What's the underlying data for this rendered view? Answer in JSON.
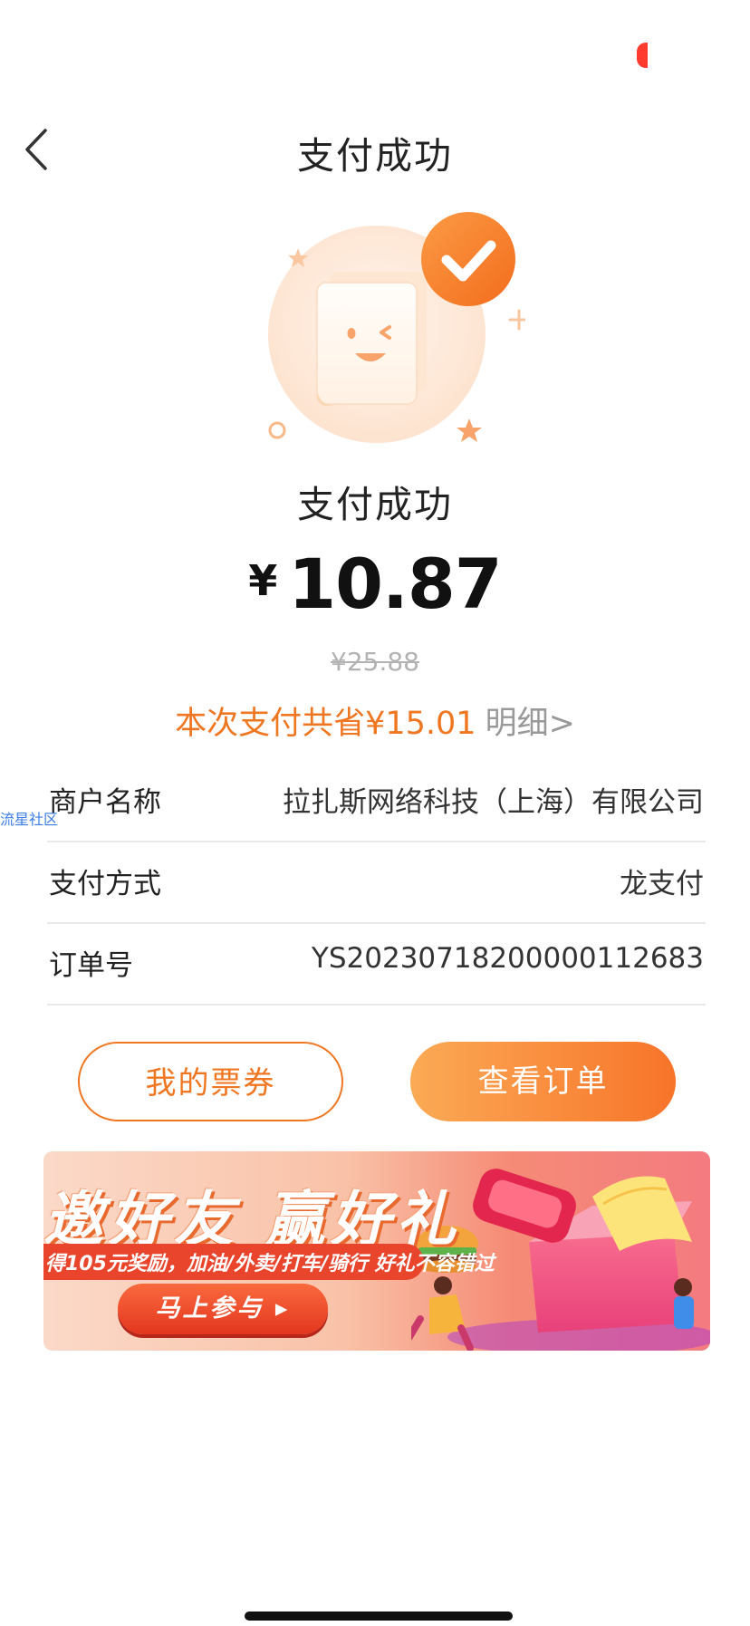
{
  "header": {
    "title": "支付成功"
  },
  "result": {
    "status_text": "支付成功",
    "currency_symbol": "¥",
    "amount": "10.87",
    "original_price": "¥25.88",
    "savings_text": "本次支付共省¥15.01",
    "savings_detail_link": "明细>"
  },
  "details": [
    {
      "label": "商户名称",
      "value": "拉扎斯网络科技（上海）有限公司"
    },
    {
      "label": "支付方式",
      "value": "龙支付"
    },
    {
      "label": "订单号",
      "value": "YS20230718200000112683"
    }
  ],
  "watermark": "流星社区",
  "actions": {
    "tickets_label": "我的票券",
    "view_order_label": "查看订单"
  },
  "banner": {
    "title": "邀好友 赢好礼",
    "subtitle": "得105元奖励，加油/外卖/打车/骑行 好礼不容错过",
    "cta": "马上参与 ▸"
  },
  "colors": {
    "accent": "#f07722",
    "accent_gradient_start": "#fbaa55",
    "accent_gradient_end": "#f7742a",
    "muted_text": "#999999",
    "divider": "#e9e9e9"
  },
  "icons": {
    "back": "chevron-left-icon",
    "success": "success-check-icon"
  }
}
